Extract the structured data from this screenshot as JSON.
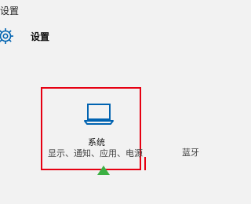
{
  "window": {
    "title": "设置"
  },
  "header": {
    "icon": "gear-icon",
    "label": "设置"
  },
  "tiles": [
    {
      "icon": "laptop-icon",
      "title": "系统",
      "description": "显示、通知、应用、电源"
    },
    {
      "title": "蓝牙"
    }
  ],
  "colors": {
    "accent": "#0063b1",
    "highlight_border": "#e60012",
    "cursor": "#3cb043",
    "background": "#f2f2f2"
  }
}
